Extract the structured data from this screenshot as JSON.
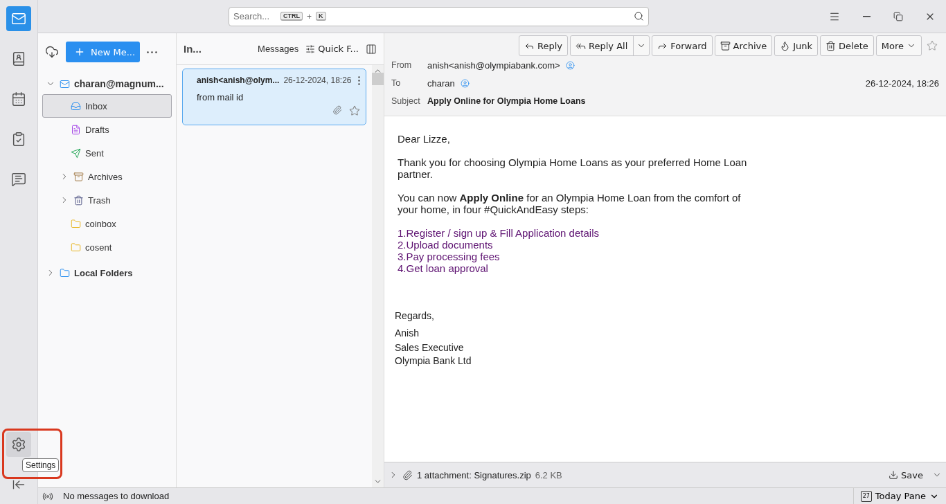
{
  "search": {
    "placeholder": "Search...",
    "keys": [
      "CTRL",
      "+",
      "K"
    ]
  },
  "spaces": {
    "settings_tooltip": "Settings"
  },
  "folder_pane": {
    "new_message": "New Me...",
    "account": {
      "name": "charan@magnum...",
      "expanded": true,
      "folders": [
        {
          "name": "Inbox",
          "kind": "inbox",
          "selected": true
        },
        {
          "name": "Drafts",
          "kind": "drafts",
          "selected": false
        },
        {
          "name": "Sent",
          "kind": "sent",
          "selected": false
        },
        {
          "name": "Archives",
          "kind": "archives",
          "selected": false,
          "expanded": false
        },
        {
          "name": "Trash",
          "kind": "trash",
          "selected": false,
          "expanded": false
        },
        {
          "name": "coinbox",
          "kind": "folder",
          "selected": false
        },
        {
          "name": "cosent",
          "kind": "folder",
          "selected": false
        }
      ]
    },
    "local_folders": {
      "name": "Local Folders",
      "expanded": false
    }
  },
  "message_list": {
    "title": "In...",
    "view": "Messages",
    "quick_filter": "Quick F...",
    "messages": [
      {
        "sender": "anish<anish@olym...",
        "date": "26-12-2024, 18:26",
        "subject": "from mail id",
        "selected": true,
        "attachment": true,
        "starred": false
      }
    ]
  },
  "reader": {
    "toolbar": [
      "Reply",
      "Reply All",
      "Forward",
      "Archive",
      "Junk",
      "Delete",
      "More"
    ],
    "from_label": "From",
    "from": "anish<anish@olympiabank.com>",
    "to_label": "To",
    "to": "charan",
    "date": "26-12-2024, 18:26",
    "subject_label": "Subject",
    "subject": "Apply Online for Olympia Home Loans",
    "body": {
      "greeting": "Dear  Lizze,",
      "paragraphs": [
        "Thank you for choosing Olympia Home Loans as your preferred Home Loan partner.",
        "You can now **Apply Online** for an Olympia Home Loan from the comfort of your home, in four #QuickAndEasy steps:"
      ],
      "steps": [
        "1.Register / sign up & Fill Application details",
        "2.Upload documents",
        "3.Pay processing fees",
        "4.Get loan approval"
      ],
      "signature": [
        "Regards,",
        "Anish",
        "Sales Executive",
        "Olympia Bank Ltd"
      ]
    },
    "attachment": {
      "summary": "1 attachment: Signatures.zip",
      "size": "6.2 KB",
      "save": "Save"
    }
  },
  "status_bar": {
    "message": "No messages to download",
    "today_pane": "Today Pane",
    "day": "27"
  }
}
